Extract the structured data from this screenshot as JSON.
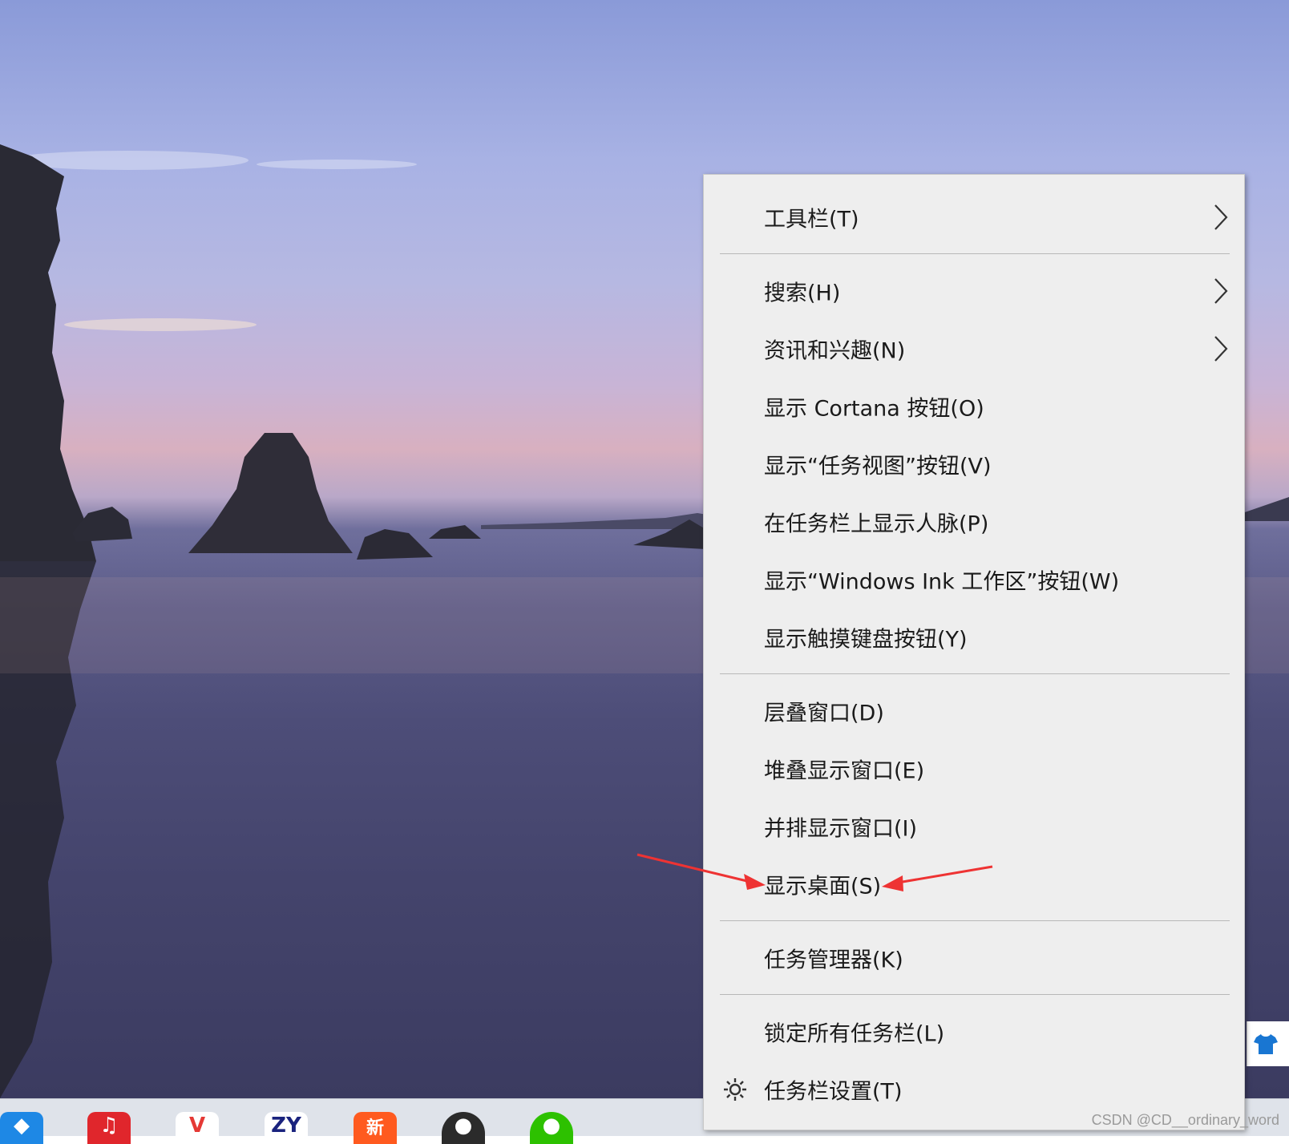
{
  "menu": {
    "items": [
      {
        "label": "工具栏(T)",
        "submenu": true
      },
      {
        "label": "搜索(H)",
        "submenu": true
      },
      {
        "label": "资讯和兴趣(N)",
        "submenu": true
      },
      {
        "label": "显示 Cortana 按钮(O)",
        "submenu": false
      },
      {
        "label": "显示“任务视图”按钮(V)",
        "submenu": false
      },
      {
        "label": "在任务栏上显示人脉(P)",
        "submenu": false
      },
      {
        "label": "显示“Windows Ink 工作区”按钮(W)",
        "submenu": false
      },
      {
        "label": "显示触摸键盘按钮(Y)",
        "submenu": false
      },
      {
        "label": "层叠窗口(D)",
        "submenu": false
      },
      {
        "label": "堆叠显示窗口(E)",
        "submenu": false
      },
      {
        "label": "并排显示窗口(I)",
        "submenu": false
      },
      {
        "label": "显示桌面(S)",
        "submenu": false,
        "annotated": true
      },
      {
        "label": "任务管理器(K)",
        "submenu": false
      },
      {
        "label": "锁定所有任务栏(L)",
        "submenu": false
      },
      {
        "label": "任务栏设置(T)",
        "submenu": false,
        "icon": "gear-icon"
      }
    ]
  },
  "taskbar": {
    "icons": [
      {
        "name": "app-blue-icon",
        "color": "#1e88e5",
        "glyph": "◆"
      },
      {
        "name": "netease-music-icon",
        "color": "#e0262c",
        "glyph": "♫"
      },
      {
        "name": "app-red-v-icon",
        "color": "#ffffff",
        "glyph": "V"
      },
      {
        "name": "zy-app-icon",
        "color": "#ffffff",
        "glyph": "ZY"
      },
      {
        "name": "app-orange-icon",
        "color": "#ff5a1f",
        "glyph": "新"
      },
      {
        "name": "avatar-icon",
        "color": "#2b2b2b",
        "glyph": "●"
      },
      {
        "name": "wechat-icon",
        "color": "#2dc100",
        "glyph": "●"
      }
    ]
  },
  "annotation_color": "#ee3333",
  "watermark": "CSDN @CD__ordinary_word"
}
